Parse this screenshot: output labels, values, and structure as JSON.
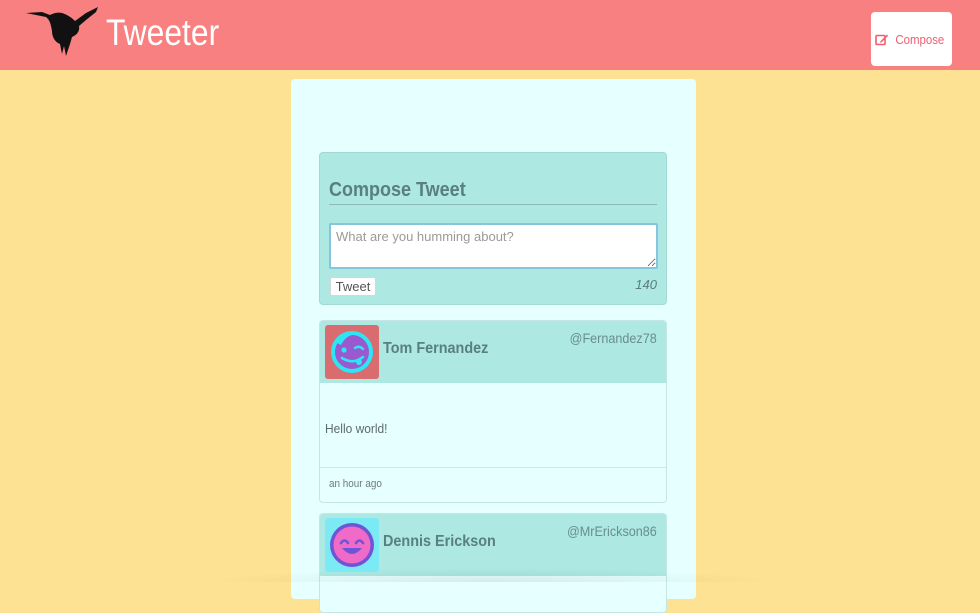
{
  "nav": {
    "brand": "Tweeter",
    "logo_icon": "hummingbird-icon",
    "compose_button": {
      "icon": "edit-icon",
      "label": "Compose"
    }
  },
  "compose": {
    "title": "Compose Tweet",
    "placeholder": "What are you humming about?",
    "value": "",
    "tweet_button": "Tweet",
    "counter": "140"
  },
  "tweets": [
    {
      "name": "Tom Fernandez",
      "handle": "@Fernandez78",
      "avatar_icon": "winking-face-avatar-icon",
      "body": "Hello world!",
      "time": "an hour ago"
    },
    {
      "name": "Dennis Erickson",
      "handle": "@MrErickson86",
      "avatar_icon": "smiling-face-avatar-icon"
    }
  ],
  "colors": {
    "page_bg": "#fde293",
    "navbar": "#f88080",
    "panel": "#e6ffff",
    "header": "#ade8e2",
    "accent": "#f05d70"
  }
}
